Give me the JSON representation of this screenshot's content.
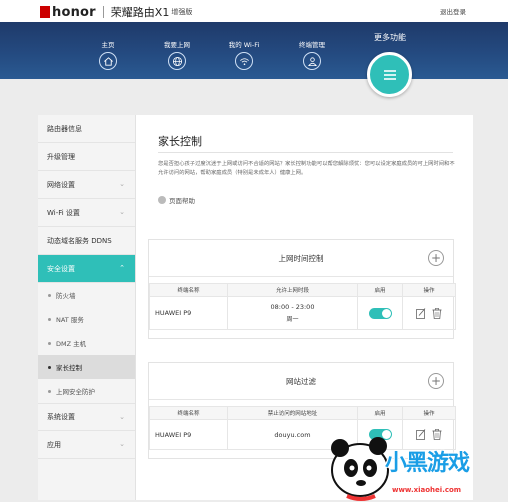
{
  "header": {
    "brand": "honor",
    "product": "荣耀路由X1",
    "product_edition": "增强版",
    "logout": "退出登录"
  },
  "nav": {
    "items": [
      {
        "label": "主页",
        "icon": "home-icon"
      },
      {
        "label": "我要上网",
        "icon": "globe-icon"
      },
      {
        "label": "我的 Wi-Fi",
        "icon": "wifi-icon"
      },
      {
        "label": "终端管理",
        "icon": "user-icon"
      }
    ],
    "more_label": "更多功能",
    "more_icon": "menu-icon"
  },
  "sidebar": {
    "items": [
      {
        "label": "路由器信息"
      },
      {
        "label": "升级管理"
      },
      {
        "label": "网络设置"
      },
      {
        "label": "Wi-Fi 设置"
      },
      {
        "label": "动态域名服务 DDNS"
      },
      {
        "label": "安全设置"
      }
    ],
    "security_sub": [
      "防火墙",
      "NAT 服务",
      "DMZ 主机",
      "家长控制",
      "上网安全防护"
    ],
    "bottom_items": [
      {
        "label": "系统设置"
      },
      {
        "label": "应用"
      }
    ]
  },
  "main": {
    "title": "家长控制",
    "description": "您是否担心孩子过度沉迷于上网或访问不合适的网站？家长控制功能可以帮您解除烦忧：您可以设定家庭成员的可上网时间和不允许访问的网站，帮助家庭成员（特别是未成年人）健康上网。",
    "help": "页面帮助"
  },
  "time_control": {
    "title": "上网时间控制",
    "columns": [
      "终端名称",
      "允许上网时段",
      "启用",
      "操作"
    ],
    "rows": [
      {
        "device": "HUAWEI P9",
        "time": "08:00 - 23:00",
        "days": "周一",
        "enabled": true
      }
    ]
  },
  "site_filter": {
    "title": "网站过滤",
    "columns": [
      "终端名称",
      "禁止访问的网站地址",
      "启用",
      "操作"
    ],
    "rows": [
      {
        "device": "HUAWEI P9",
        "site": "douyu.com",
        "enabled": true
      }
    ]
  },
  "watermark": {
    "name": "小黑游戏",
    "url": "www.xiaohei.com"
  },
  "colors": {
    "accent": "#2fbfb8",
    "nav_bg": "#244a80"
  }
}
